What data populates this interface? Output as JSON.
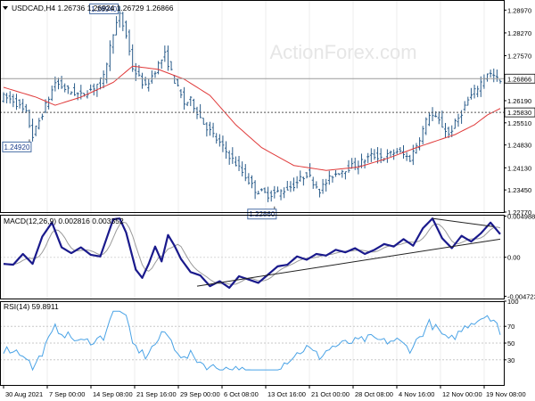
{
  "watermark": "ActionForex.com",
  "chart_data": [
    {
      "type": "candlestick",
      "title": "USDCAD,H4  1.26736 1.26924 1.26729 1.26866",
      "symbol": "USDCAD,H4",
      "ohlc": {
        "open": 1.26736,
        "high": 1.26924,
        "low": 1.26729,
        "close": 1.26866
      },
      "ylim": [
        1.2277,
        1.2928
      ],
      "yticks": [
        "1.28970",
        "1.28270",
        "1.27570",
        "1.26866",
        "1.26190",
        "1.25830",
        "1.25510",
        "1.24830",
        "1.24130",
        "1.23450",
        "1.22770"
      ],
      "price_labels": [
        {
          "label": "1.26866",
          "value": 1.26866,
          "style": "current",
          "line": "solid"
        },
        {
          "label": "1.25830",
          "value": 1.2583,
          "style": "level",
          "line": "dashed"
        }
      ],
      "annotations": [
        {
          "label": "1.28940",
          "value": 1.2894,
          "bar": 35
        },
        {
          "label": "1.24920",
          "value": 1.2492,
          "bar": 8
        },
        {
          "label": "1.22860",
          "value": 1.2286,
          "bar": 84
        }
      ],
      "close_series_anchors": [
        [
          0,
          1.263
        ],
        [
          3,
          1.262
        ],
        [
          7,
          1.258
        ],
        [
          9,
          1.251
        ],
        [
          12,
          1.258
        ],
        [
          16,
          1.2675
        ],
        [
          20,
          1.265
        ],
        [
          24,
          1.2635
        ],
        [
          28,
          1.266
        ],
        [
          31,
          1.269
        ],
        [
          34,
          1.283
        ],
        [
          36,
          1.288
        ],
        [
          38,
          1.282
        ],
        [
          40,
          1.272
        ],
        [
          44,
          1.266
        ],
        [
          48,
          1.273
        ],
        [
          50,
          1.276
        ],
        [
          53,
          1.268
        ],
        [
          56,
          1.261
        ],
        [
          58,
          1.262
        ],
        [
          62,
          1.255
        ],
        [
          66,
          1.25
        ],
        [
          70,
          1.245
        ],
        [
          74,
          1.24
        ],
        [
          78,
          1.2345
        ],
        [
          82,
          1.233
        ],
        [
          86,
          1.234
        ],
        [
          90,
          1.236
        ],
        [
          94,
          1.2395
        ],
        [
          98,
          1.2345
        ],
        [
          102,
          1.239
        ],
        [
          106,
          1.241
        ],
        [
          110,
          1.2425
        ],
        [
          114,
          1.245
        ],
        [
          118,
          1.2445
        ],
        [
          122,
          1.2465
        ],
        [
          126,
          1.244
        ],
        [
          129,
          1.2505
        ],
        [
          132,
          1.258
        ],
        [
          135,
          1.2555
        ],
        [
          138,
          1.2515
        ],
        [
          141,
          1.2565
        ],
        [
          144,
          1.262
        ],
        [
          147,
          1.266
        ],
        [
          150,
          1.2705
        ],
        [
          152,
          1.2694
        ],
        [
          154,
          1.2675
        ]
      ],
      "ma_anchors": [
        [
          0,
          1.266
        ],
        [
          10,
          1.263
        ],
        [
          16,
          1.2605
        ],
        [
          24,
          1.263
        ],
        [
          34,
          1.2675
        ],
        [
          40,
          1.2725
        ],
        [
          48,
          1.2715
        ],
        [
          56,
          1.2685
        ],
        [
          64,
          1.2635
        ],
        [
          72,
          1.2545
        ],
        [
          80,
          1.2475
        ],
        [
          90,
          1.242
        ],
        [
          100,
          1.2405
        ],
        [
          110,
          1.2415
        ],
        [
          120,
          1.2445
        ],
        [
          128,
          1.2475
        ],
        [
          134,
          1.2495
        ],
        [
          140,
          1.2515
        ],
        [
          146,
          1.2545
        ],
        [
          150,
          1.2575
        ],
        [
          154,
          1.2595
        ]
      ],
      "ma_color": "#e03a3a",
      "candle_color": "#2a5c8a"
    },
    {
      "type": "line",
      "title": "MACD(12,26,9) 0.002816 0.003352",
      "ylim": [
        -0.005,
        0.00515
      ],
      "yticks": [
        "0.004988",
        "0.00",
        "-0.004723"
      ],
      "series": [
        {
          "name": "MACD",
          "values_anchors": [
            [
              0,
              -0.0008
            ],
            [
              3,
              -0.0009
            ],
            [
              6,
              0.0004
            ],
            [
              9,
              -0.0008
            ],
            [
              12,
              0.0025
            ],
            [
              15,
              0.0042
            ],
            [
              18,
              0.0012
            ],
            [
              21,
              0.0005
            ],
            [
              24,
              0.0012
            ],
            [
              27,
              0.0003
            ],
            [
              30,
              0.0001
            ],
            [
              34,
              0.0046
            ],
            [
              36,
              0.0047
            ],
            [
              38,
              0.003
            ],
            [
              41,
              -0.0015
            ],
            [
              43,
              -0.0025
            ],
            [
              45,
              -0.0008
            ],
            [
              47,
              0.0013
            ],
            [
              49,
              -0.0005
            ],
            [
              51,
              0.0027
            ],
            [
              53,
              0.0014
            ],
            [
              55,
              -0.0002
            ],
            [
              58,
              -0.0018
            ],
            [
              61,
              -0.0022
            ],
            [
              64,
              -0.0035
            ],
            [
              67,
              -0.0029
            ],
            [
              70,
              -0.0037
            ],
            [
              73,
              -0.0023
            ],
            [
              76,
              -0.0027
            ],
            [
              79,
              -0.0031
            ],
            [
              82,
              -0.0021
            ],
            [
              85,
              -0.0011
            ],
            [
              88,
              -0.0009
            ],
            [
              91,
              0.0001
            ],
            [
              94,
              -0.0003
            ],
            [
              97,
              0.0004
            ],
            [
              100,
              0.0002
            ],
            [
              103,
              0.0009
            ],
            [
              106,
              0.0006
            ],
            [
              109,
              0.0011
            ],
            [
              112,
              0.0004
            ],
            [
              115,
              0.0009
            ],
            [
              118,
              0.0016
            ],
            [
              121,
              0.0013
            ],
            [
              124,
              0.0022
            ],
            [
              127,
              0.0014
            ],
            [
              130,
              0.0035
            ],
            [
              133,
              0.0047
            ],
            [
              136,
              0.0023
            ],
            [
              139,
              0.0011
            ],
            [
              142,
              0.0026
            ],
            [
              145,
              0.0019
            ],
            [
              148,
              0.0029
            ],
            [
              151,
              0.0042
            ],
            [
              154,
              0.0028
            ]
          ],
          "color": "#1a1a8c"
        },
        {
          "name": "Signal",
          "color": "#9a9a9a"
        }
      ],
      "trendlines": [
        {
          "from": [
            60,
            -0.0035
          ],
          "to": [
            154,
            0.0022
          ]
        },
        {
          "from": [
            133,
            0.0047
          ],
          "to": [
            152,
            0.0037
          ]
        }
      ]
    },
    {
      "type": "line",
      "title": "RSI(14) 59.8911",
      "ylim": [
        0,
        100
      ],
      "yticks": [
        "100",
        "70",
        "50",
        "30"
      ],
      "series": [
        {
          "name": "RSI(14)",
          "last": 59.8911,
          "color": "#4aa3e6"
        }
      ]
    }
  ],
  "x_axis_labels": [
    "30 Aug 2021",
    "7 Sep 00:00",
    "14 Sep 08:00",
    "21 Sep 16:00",
    "29 Sep 00:00",
    "6 Oct 08:00",
    "13 Oct 16:00",
    "21 Oct 00:00",
    "28 Oct 08:00",
    "4 Nov 16:00",
    "12 Nov 00:00",
    "19 Nov 08:00"
  ]
}
